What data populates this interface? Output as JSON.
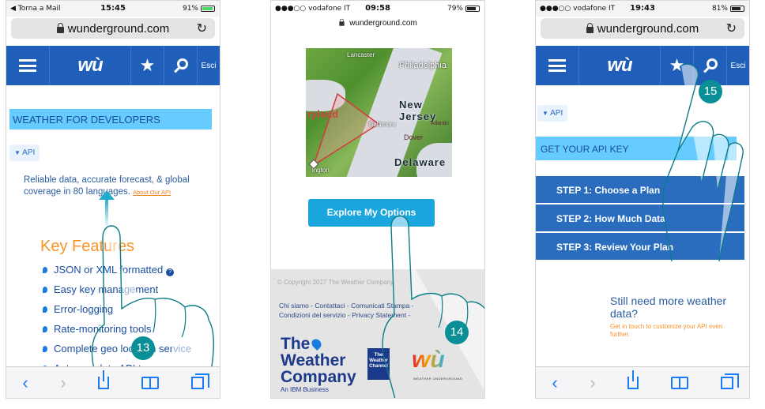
{
  "phone1": {
    "status": {
      "left": "◀ Torna a Mail",
      "time": "15:45",
      "right": "91%"
    },
    "url": "wunderground.com",
    "nav": {
      "logo": "wù",
      "exit": "Esci"
    },
    "banner": "WEATHER FOR DEVELOPERS",
    "api_tag": "API",
    "paragraph": "Reliable data, accurate forecast, & global coverage in 80 languages.",
    "about_link": "About Our API",
    "key_features_title": "Key Features",
    "features": [
      "JSON or XML formatted",
      "Easy key management",
      "Error-logging",
      "Rate-monitoring tools",
      "Complete geo location service",
      "Autocomplete API to power geo"
    ],
    "badge": "13"
  },
  "phone2": {
    "status": {
      "left": "●●●○○ vodafone IT",
      "time": "09:58",
      "right": "79%"
    },
    "url": "wunderground.com",
    "map_labels": [
      "Philadelphia",
      "New Jersey",
      "Delaware",
      "Baltimore",
      "Dover",
      "Atlantic",
      "Lancaster",
      "ryland",
      "ington"
    ],
    "button": "Explore My Options",
    "copyright": "© Copyright 2017 The Weather Company",
    "links": [
      "Chi siamo - Contattaci - Comunicati Stampa -",
      "Condizioni del servizio - Privacy Statement -"
    ],
    "twc": {
      "line1": "The",
      "line2": "Weather",
      "line3": "Company",
      "sub": "An IBM Business"
    },
    "channel": "The Weather Channel",
    "wu_logo": "wù",
    "wu_sub": "WEATHER UNDERGROUND",
    "badge": "14"
  },
  "phone3": {
    "status": {
      "left": "●●●○○ vodafone IT",
      "time": "19:43",
      "right": "81%"
    },
    "url": "wunderground.com",
    "nav": {
      "logo": "wù",
      "exit": "Esci"
    },
    "api_tag": "API",
    "banner": "GET YOUR API KEY",
    "steps": [
      "STEP 1: Choose a Plan",
      "STEP 2: How Much Data",
      "STEP 3: Review Your Plan"
    ],
    "need_title": "Still need more weather data?",
    "need_sub": "Get in touch to customize your API even further.",
    "badge": "15"
  },
  "colors": {
    "nav_blue": "#1f5fba",
    "banner_cyan": "#66ccff",
    "orange": "#f79327",
    "step_blue": "#2a6dbf",
    "badge_teal": "#0a8f97"
  }
}
